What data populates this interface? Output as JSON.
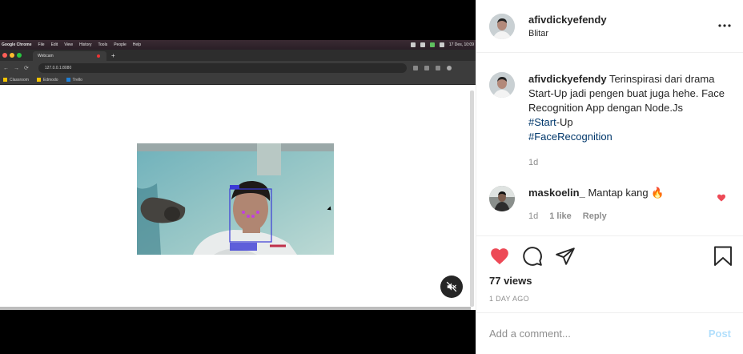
{
  "media": {
    "menubar": {
      "app": "Google Chrome",
      "items": [
        "File",
        "Edit",
        "View",
        "History",
        "Tools",
        "People",
        "Help"
      ],
      "clock": "17 Des, 10:09"
    },
    "tab_title": "Webcam",
    "new_tab": "+",
    "url": "127.0.0.1:8080",
    "bookmarks": [
      "Classroom",
      "Edmodo",
      "Trello"
    ],
    "colors": {
      "close": "#ff5f57",
      "minimize": "#febc2e",
      "maximize": "#28c840",
      "face_box": "#3b3bd6"
    },
    "mute_icon": "speaker-muted-icon"
  },
  "post": {
    "username": "afivdickyefendy",
    "location": "Blitar",
    "caption": {
      "author": "afivdickyefendy",
      "text": "Terinspirasi dari drama Start-Up jadi pengen buat juga hehe. Face Recognition App dengan Node.Js",
      "tag1": "#Start",
      "tag1_suffix": "-Up",
      "tag2": "#FaceRecognition",
      "time": "1d"
    },
    "comment": {
      "author": "maskoelin_",
      "text": "Mantap kang 🔥",
      "time": "1d",
      "likes": "1 like",
      "reply": "Reply"
    },
    "views": "77 views",
    "ago": "1 DAY AGO",
    "add_comment_placeholder": "Add a comment...",
    "post_label": "Post",
    "colors": {
      "like": "#ed4956",
      "link": "#00376b",
      "muted": "#8e8e8e",
      "post": "#b2dffc"
    }
  }
}
